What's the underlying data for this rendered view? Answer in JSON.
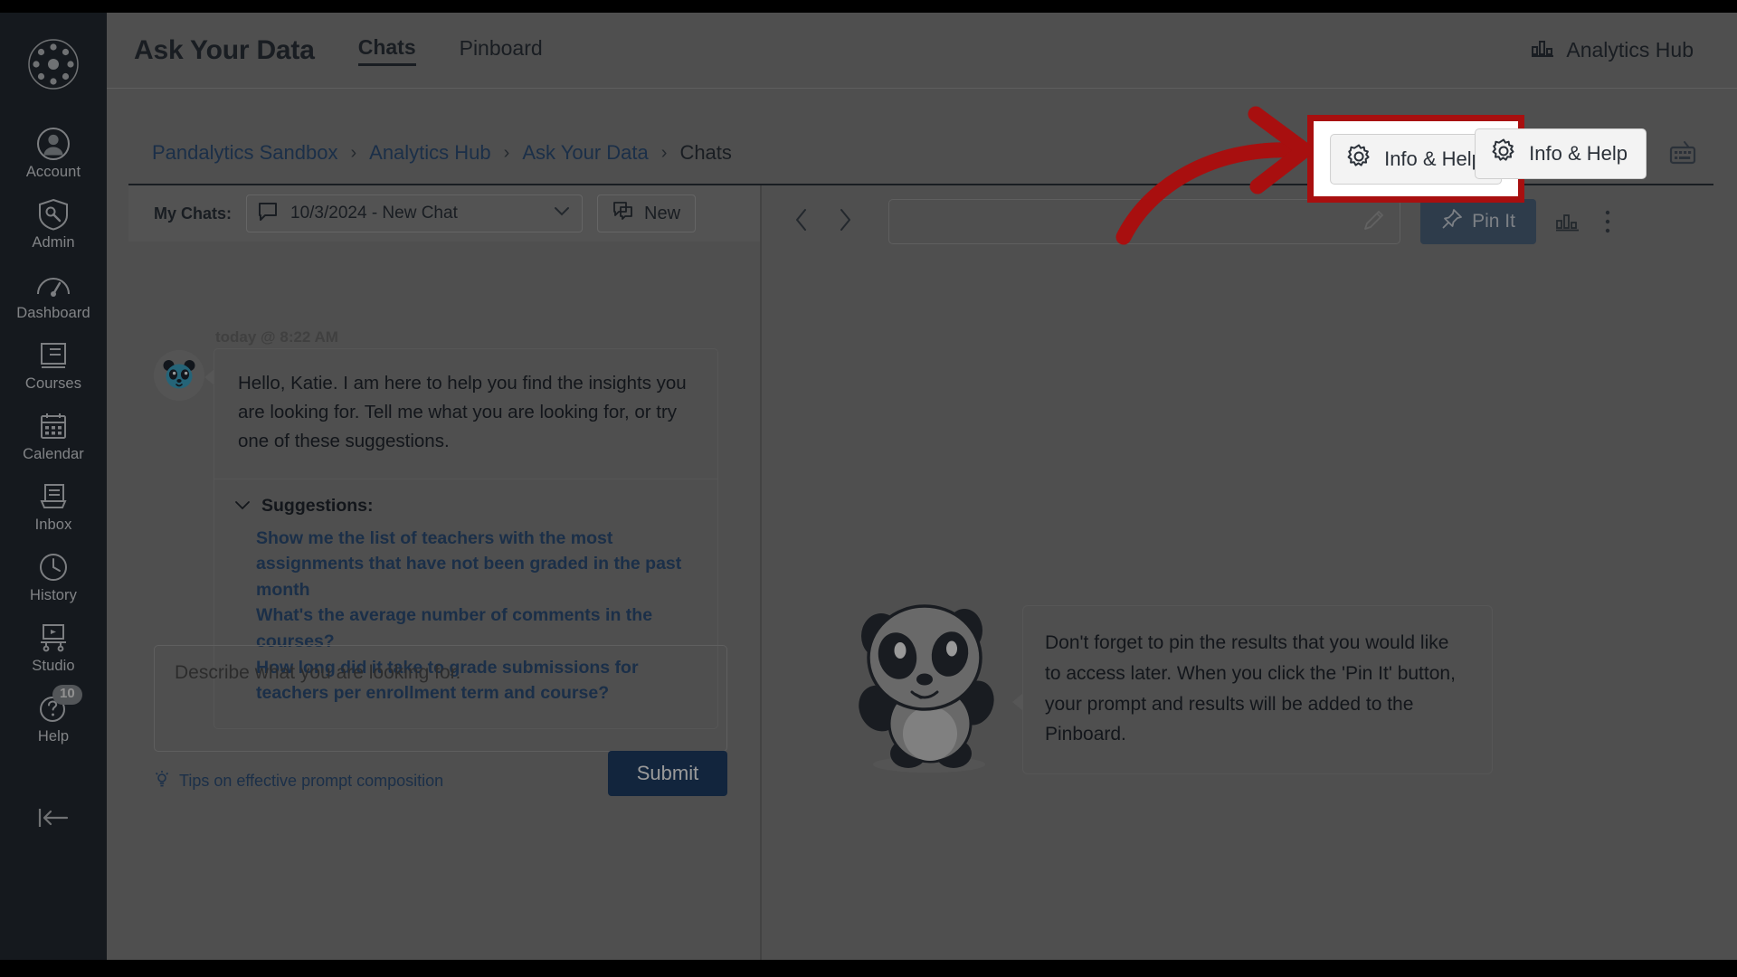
{
  "app": {
    "title": "Ask Your Data",
    "tabs": [
      {
        "label": "Chats",
        "active": true
      },
      {
        "label": "Pinboard",
        "active": false
      }
    ],
    "hub_label": "Analytics Hub",
    "hub_icon": "bar-chart-icon"
  },
  "sidebar": {
    "logo_icon": "canvas-logo-icon",
    "items": [
      {
        "label": "Account",
        "icon": "user-circle-icon",
        "badge": null
      },
      {
        "label": "Admin",
        "icon": "shield-wrench-icon",
        "badge": null
      },
      {
        "label": "Dashboard",
        "icon": "gauge-icon",
        "badge": null
      },
      {
        "label": "Courses",
        "icon": "book-icon",
        "badge": null
      },
      {
        "label": "Calendar",
        "icon": "calendar-icon",
        "badge": null
      },
      {
        "label": "Inbox",
        "icon": "inbox-tray-icon",
        "badge": null
      },
      {
        "label": "History",
        "icon": "clock-icon",
        "badge": null
      },
      {
        "label": "Studio",
        "icon": "studio-screen-icon",
        "badge": null
      },
      {
        "label": "Help",
        "icon": "question-face-icon",
        "badge": "10"
      }
    ],
    "collapse_icon": "collapse-left-icon"
  },
  "breadcrumb": [
    {
      "label": "Pandalytics Sandbox",
      "link": true
    },
    {
      "label": "Analytics Hub",
      "link": true
    },
    {
      "label": "Ask Your Data",
      "link": true
    },
    {
      "label": "Chats",
      "link": false
    }
  ],
  "breadcrumb_separator": "›",
  "tools": {
    "info_help_label": "Info & Help",
    "info_help_icon": "gear-icon",
    "keyboard_icon": "keyboard-icon"
  },
  "annotation": {
    "highlight_color": "#a80f0f",
    "arrow_icon": "curved-arrow-right-icon",
    "target": "Info & Help"
  },
  "chat_panel": {
    "my_chats_label": "My Chats:",
    "selected_chat": "10/3/2024 - New Chat",
    "select_icon": "speech-bubble-icon",
    "chevron_icon": "chevron-down-icon",
    "new_button_label": "New",
    "new_button_icon": "new-chat-icon",
    "message": {
      "timestamp": "today @ 8:22 AM",
      "avatar_icon": "panda-avatar-icon",
      "text": "Hello, Katie. I am here to help you find the insights you are looking for. Tell me what you are looking for, or try one of these suggestions."
    },
    "suggestions_header": "Suggestions:",
    "suggestions_chevron": "chevron-down-icon",
    "suggestions": [
      "Show me the list of teachers with the most assignments that have not been graded in the past month",
      "What's the average number of comments in the courses?",
      "How long did it take to grade submissions for teachers per enrollment term and course?"
    ],
    "prompt_placeholder": "Describe what you are looking for.",
    "prompt_value": "",
    "tips_label": "Tips on effective prompt composition",
    "tips_icon": "lightbulb-icon",
    "submit_label": "Submit"
  },
  "result_panel": {
    "prev_icon": "chevron-left-icon",
    "next_icon": "chevron-right-icon",
    "title_value": "",
    "title_placeholder": "",
    "edit_icon": "pencil-icon",
    "pin_label": "Pin It",
    "pin_icon": "pushpin-icon",
    "chart_toggle_icon": "bar-chart-icon",
    "kebab_icon": "more-vertical-icon",
    "mascot_icon": "panda-mascot-icon",
    "tip_text": "Don't forget to pin the results that you would like to access later. When you click the 'Pin It' button, your prompt and results will be added to the Pinboard."
  },
  "colors": {
    "nav_bg": "#242b33",
    "link": "#2d4f79",
    "submit_bg": "#1e3f66",
    "pin_bg": "#4d647e",
    "annotation_red": "#a80f0f"
  }
}
